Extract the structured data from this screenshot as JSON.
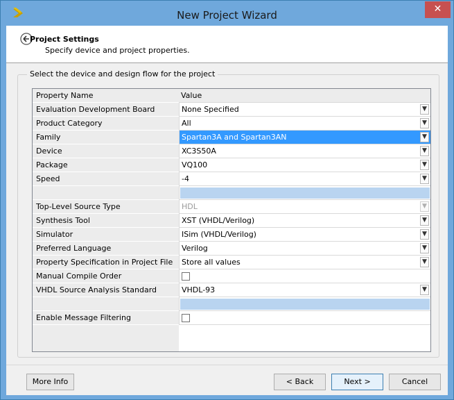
{
  "window": {
    "title": "New Project Wizard",
    "close_glyph": "✕"
  },
  "header": {
    "title": "Project Settings",
    "subtitle": "Specify device and project properties."
  },
  "group": {
    "label": "Select the device and design flow for the project"
  },
  "table": {
    "col_property": "Property Name",
    "col_value": "Value",
    "rows": [
      {
        "name": "Evaluation Development Board",
        "value": "None Specified"
      },
      {
        "name": "Product Category",
        "value": "All"
      },
      {
        "name": "Family",
        "value": "Spartan3A and Spartan3AN",
        "selected": true
      },
      {
        "name": "Device",
        "value": "XC3S50A"
      },
      {
        "name": "Package",
        "value": "VQ100"
      },
      {
        "name": "Speed",
        "value": "-4"
      },
      {
        "name": "",
        "value": ""
      },
      {
        "name": "Top-Level Source Type",
        "value": "HDL",
        "disabled": true
      },
      {
        "name": "Synthesis Tool",
        "value": "XST (VHDL/Verilog)"
      },
      {
        "name": "Simulator",
        "value": "ISim (VHDL/Verilog)"
      },
      {
        "name": "Preferred Language",
        "value": "Verilog"
      },
      {
        "name": "Property Specification in Project File",
        "value": "Store all values"
      },
      {
        "name": "Manual Compile Order",
        "value": ""
      },
      {
        "name": "VHDL Source Analysis Standard",
        "value": "VHDL-93"
      },
      {
        "name": "",
        "value": ""
      },
      {
        "name": "Enable Message Filtering",
        "value": ""
      }
    ]
  },
  "buttons": {
    "more_info": "More Info",
    "back": "< Back",
    "next": "Next >",
    "cancel": "Cancel"
  },
  "colors": {
    "titlebar": "#6fa8dc",
    "selection": "#3399ff",
    "close": "#c75050"
  },
  "icons": {
    "app": "xilinx-logo-icon",
    "back": "back-arrow-icon",
    "dropdown": "chevron-down-icon"
  }
}
